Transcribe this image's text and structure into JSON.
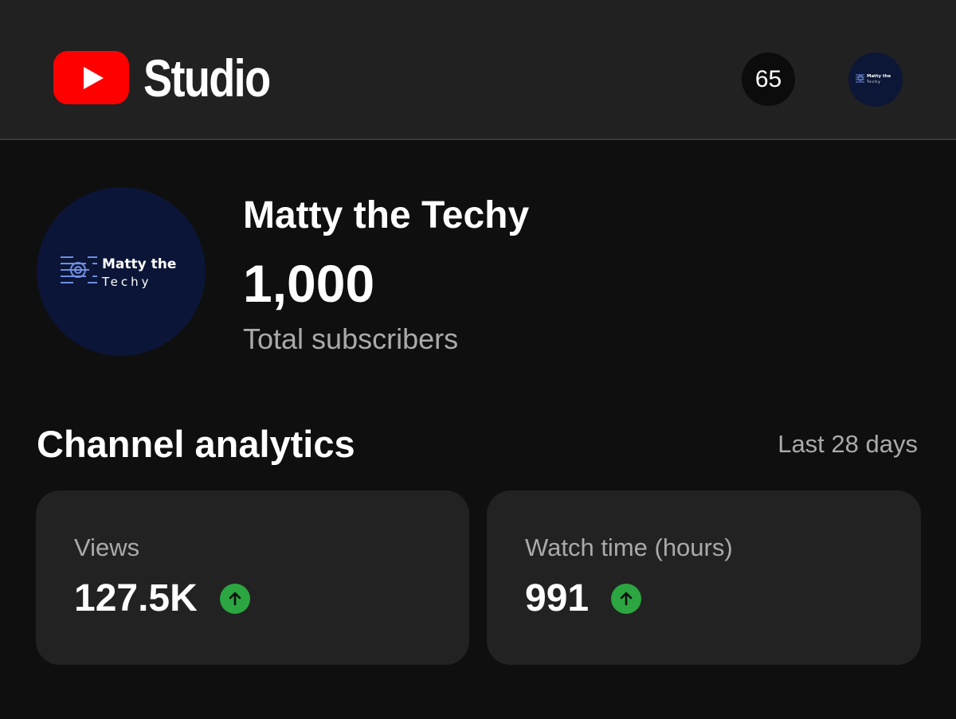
{
  "header": {
    "brand_label": "Studio",
    "notification_count": "65"
  },
  "channel": {
    "name": "Matty the Techy",
    "subscriber_count": "1,000",
    "subscriber_label": "Total subscribers",
    "avatar_text_line1": "Matty the",
    "avatar_text_line2": "Techy"
  },
  "analytics": {
    "title": "Channel analytics",
    "period": "Last 28 days",
    "cards": [
      {
        "label": "Views",
        "value": "127.5K",
        "trend": "up",
        "trend_icon": "arrow-up-icon"
      },
      {
        "label": "Watch time (hours)",
        "value": "991",
        "trend": "up",
        "trend_icon": "arrow-up-icon"
      }
    ]
  },
  "colors": {
    "brand_red": "#ff0000",
    "trend_green": "#2ba640",
    "avatar_navy": "#0b1537",
    "muted_text": "#aaaaaa"
  }
}
